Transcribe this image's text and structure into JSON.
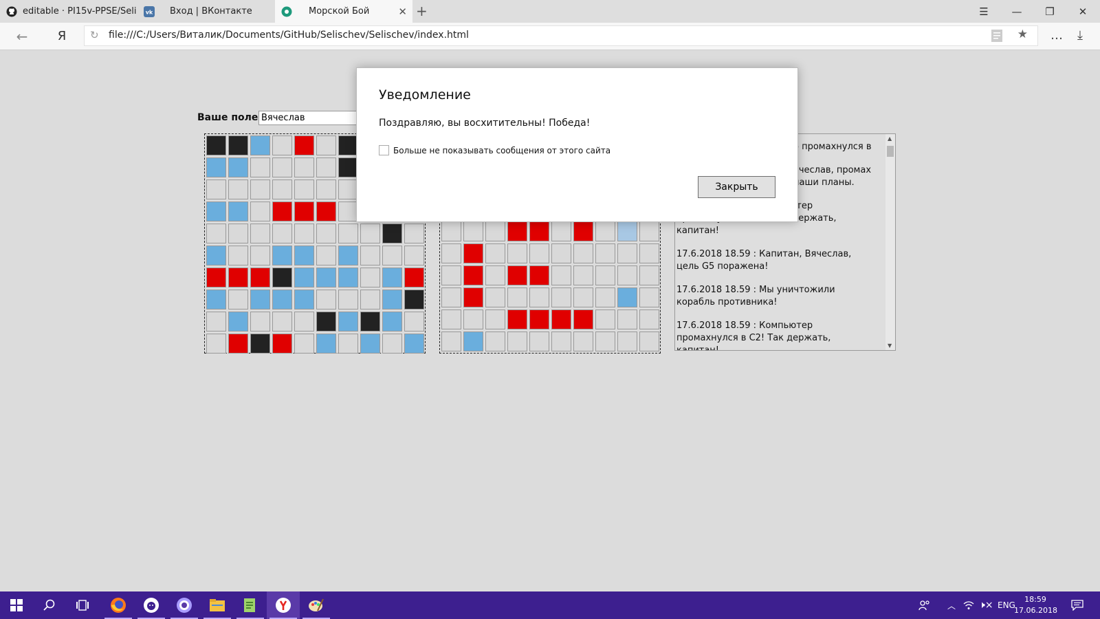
{
  "browser": {
    "tabs": [
      {
        "title": "editable · PI15v-PPSE/Selisch",
        "icon": "github-icon"
      },
      {
        "title": "Вход | ВКонтакте",
        "icon": "vk-icon"
      },
      {
        "title": "Морской Бой",
        "icon": "site-favicon-icon",
        "active": true
      }
    ],
    "yandex_button": "Я",
    "url": "file:///C:/Users/Виталик/Documents/GitHub/Selischev/Selischev/index.html"
  },
  "game": {
    "field_label": "Ваше поле,",
    "player_name": "Вячеслав",
    "legend": {
      "0": "empty",
      "1": "ship",
      "2": "miss",
      "3": "hit",
      "4": "marked"
    },
    "colors": {
      "empty": "#d9d9d9",
      "ship": "#222222",
      "miss": "#6aaedd",
      "hit": "#e00000",
      "marked": "#a8c8e4"
    },
    "player_grid": [
      [
        1,
        1,
        2,
        0,
        3,
        0,
        1,
        0,
        0,
        0
      ],
      [
        2,
        2,
        0,
        0,
        0,
        0,
        1,
        0,
        0,
        0
      ],
      [
        0,
        0,
        0,
        0,
        0,
        0,
        0,
        0,
        0,
        0
      ],
      [
        2,
        2,
        0,
        3,
        3,
        3,
        0,
        0,
        0,
        0
      ],
      [
        0,
        0,
        0,
        0,
        0,
        0,
        0,
        0,
        1,
        0
      ],
      [
        2,
        0,
        0,
        2,
        2,
        0,
        2,
        0,
        0,
        0
      ],
      [
        3,
        3,
        3,
        1,
        2,
        2,
        2,
        0,
        2,
        3
      ],
      [
        2,
        0,
        2,
        2,
        2,
        0,
        0,
        0,
        2,
        1
      ],
      [
        0,
        2,
        0,
        0,
        0,
        1,
        2,
        1,
        2,
        0
      ],
      [
        0,
        3,
        1,
        3,
        0,
        2,
        0,
        2,
        0,
        2
      ]
    ],
    "enemy_grid_visible_rows": [
      [
        0,
        0,
        0,
        3,
        3,
        0,
        3,
        0,
        4,
        0
      ],
      [
        0,
        3,
        0,
        0,
        0,
        0,
        0,
        0,
        0,
        0
      ],
      [
        0,
        3,
        0,
        3,
        3,
        0,
        0,
        0,
        0,
        0
      ],
      [
        0,
        3,
        0,
        0,
        0,
        0,
        0,
        0,
        2,
        0
      ],
      [
        0,
        0,
        0,
        3,
        3,
        3,
        3,
        0,
        0,
        0
      ],
      [
        0,
        2,
        0,
        0,
        0,
        0,
        0,
        0,
        0,
        0
      ]
    ]
  },
  "log": [
    "о промахнулся в",
    "ячеслав, промах\nнаши планы.",
    "17.6.2018 18.59 : Компьютер промахнулся в A10! Так держать, капитан!",
    "17.6.2018 18.59 : Капитан, Вячеслав, цель G5 поражена!",
    "17.6.2018 18.59 : Мы уничтожили корабль противника!",
    "17.6.2018 18.59 : Компьютер промахнулся в C2! Так держать, капитан!"
  ],
  "dialog": {
    "title": "Уведомление",
    "message": "Поздравляю, вы восхитительны! Победа!",
    "checkbox_label": "Больше не показывать сообщения от этого сайта",
    "close_label": "Закрыть"
  },
  "taskbar": {
    "apps": [
      "windows-start-icon",
      "search-icon",
      "task-view-icon",
      "firefox-icon",
      "github-desktop-icon",
      "gitkraken-icon",
      "file-explorer-icon",
      "notepad-icon",
      "yandex-browser-icon",
      "paint-icon"
    ],
    "language": "ENG",
    "time": "18:59",
    "date": "17.06.2018"
  }
}
